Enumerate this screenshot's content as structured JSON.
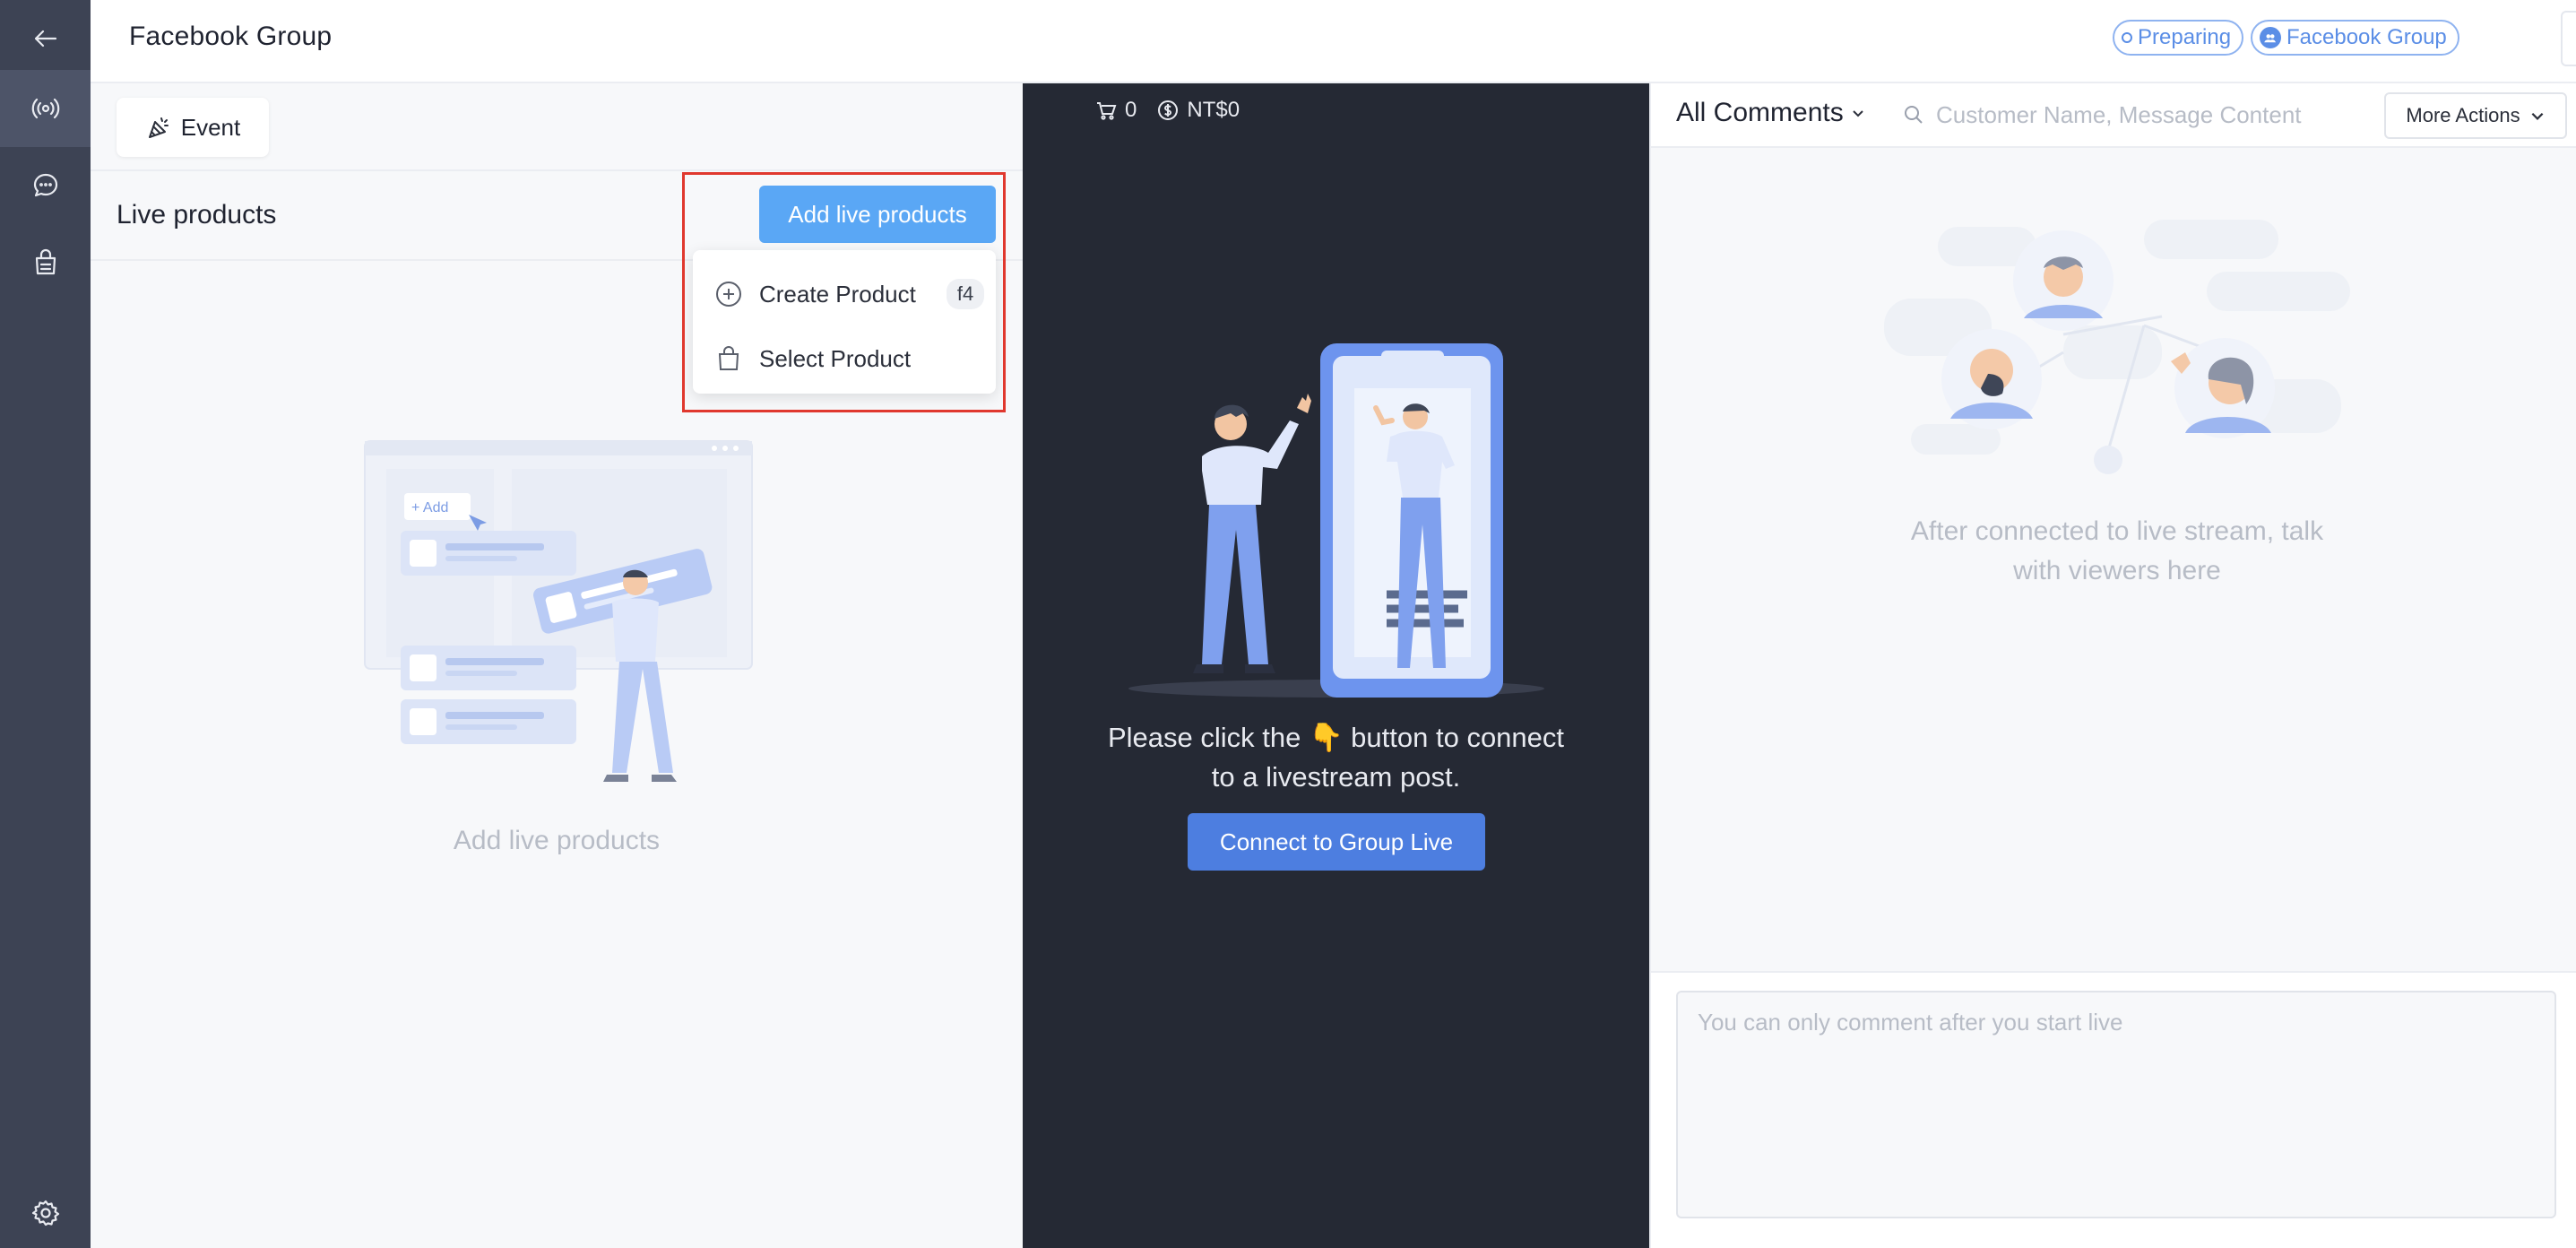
{
  "header": {
    "title": "Facebook Group",
    "status_badge": "Preparing",
    "platform_badge": "Facebook Group"
  },
  "sidebar": {
    "items": [
      {
        "icon": "back-arrow-icon"
      },
      {
        "icon": "broadcast-icon",
        "active": true
      },
      {
        "icon": "chat-bubble-icon"
      },
      {
        "icon": "store-icon"
      },
      {
        "icon": "gear-icon"
      }
    ]
  },
  "left_panel": {
    "event_button": "Event",
    "live_title": "Live products",
    "add_button": "Add live products",
    "dropdown": {
      "create": "Create Product",
      "create_shortcut": "f4",
      "select": "Select Product"
    },
    "empty_text": "Add live products",
    "illustration_add_label": "+ Add"
  },
  "middle_panel": {
    "cart_count": "0",
    "amount": "NT$0",
    "instructions_line1": "Please click the 👇 button to connect",
    "instructions_line2": "to a livestream post.",
    "connect_button": "Connect to Group Live"
  },
  "right_panel": {
    "comments_filter": "All Comments",
    "search_placeholder": "Customer Name, Message Content",
    "more_actions": "More Actions",
    "empty_line1": "After connected to live stream, talk",
    "empty_line2": "with viewers here",
    "comment_placeholder": "You can only comment after you start live"
  },
  "colors": {
    "accent": "#5aa7f5",
    "connect": "#4d7ee0",
    "rail": "#3d4354",
    "dark_panel": "#252934",
    "highlight": "#e0382e"
  }
}
